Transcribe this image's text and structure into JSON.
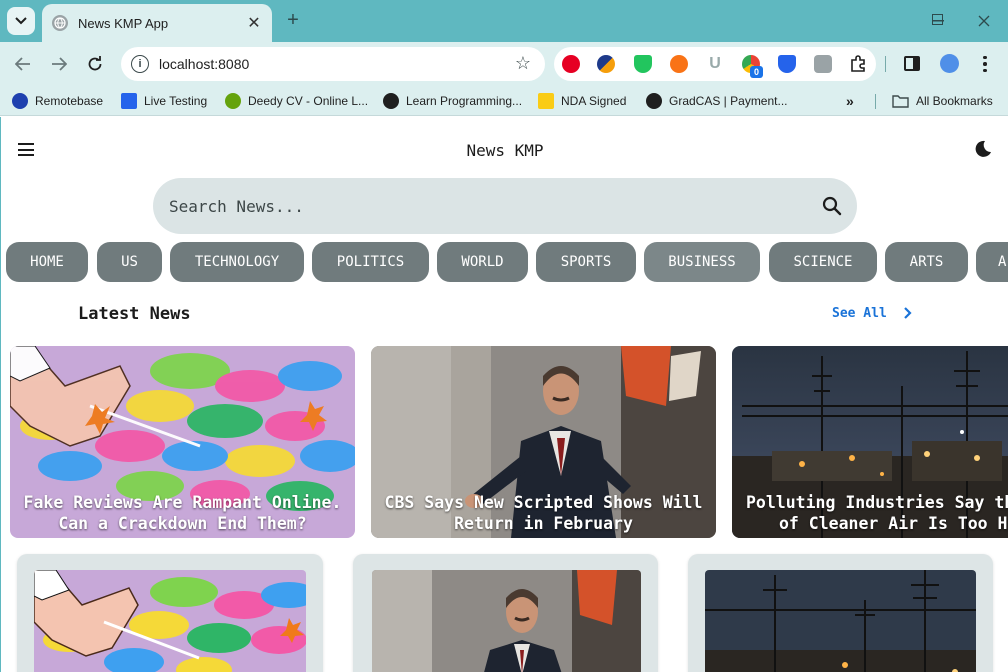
{
  "browser": {
    "tab_title": "News KMP App",
    "url": "localhost:8080",
    "bookmarks": [
      "Remotebase",
      "Live Testing",
      "Deedy CV - Online L...",
      "Learn Programming...",
      "NDA Signed",
      "GradCAS | Payment..."
    ],
    "all_bookmarks": "All Bookmarks",
    "extension_badge": "0"
  },
  "app": {
    "title": "News KMP",
    "search_placeholder": "Search News...",
    "categories": [
      "HOME",
      "US",
      "TECHNOLOGY",
      "POLITICS",
      "WORLD",
      "SPORTS",
      "BUSINESS",
      "SCIENCE",
      "ARTS",
      "A"
    ],
    "section_title": "Latest News",
    "see_all": "See All",
    "featured": [
      {
        "line1": "Fake Reviews Are Rampant Online.",
        "line2": "Can a Crackdown End Them?"
      },
      {
        "line1": "CBS Says New Scripted Shows Will",
        "line2": "Return in February"
      },
      {
        "line1": "Polluting Industries Say the",
        "line2": "of Cleaner Air Is Too Hi"
      }
    ]
  }
}
